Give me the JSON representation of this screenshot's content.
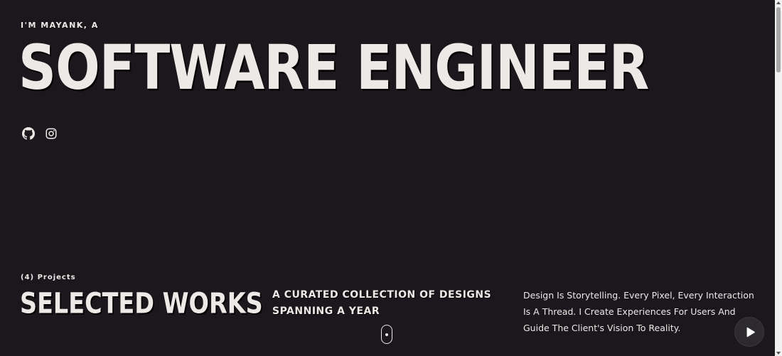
{
  "hero": {
    "intro": "I'M MAYANK, A",
    "title": "SOFTWARE ENGINEER"
  },
  "socials": [
    {
      "icon": "github-icon"
    },
    {
      "icon": "instagram-icon"
    }
  ],
  "works": {
    "count_label": "(4) Projects",
    "title": "SELECTED WORKS",
    "tagline": "A CURATED COLLECTION OF DESIGNS SPANNING A YEAR",
    "description": "Design Is Storytelling. Every Pixel, Every Interaction Is A Thread. I Create Experiences For Users And Guide The Client's Vision To Reality."
  },
  "controls": {
    "play_icon": "play-icon",
    "scroll_icon": "mouse-scroll-icon"
  },
  "colors": {
    "background": "#1b171c",
    "text": "#ece9e6",
    "play_button_bg": "#2c2a2f"
  }
}
